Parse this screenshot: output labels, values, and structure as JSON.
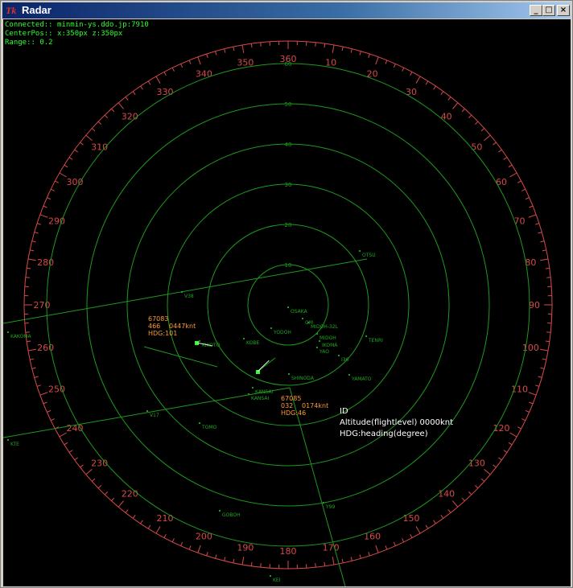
{
  "window": {
    "title": "Radar",
    "app_icon": "Tk",
    "controls": {
      "minimize": "_",
      "maximize": "□",
      "close": "×"
    }
  },
  "hud": {
    "connected": "Connected:: minmin-ys.ddo.jp:7910",
    "center_pos": "CenterPos:: x:350px z:350px",
    "range": "Range:: 0.2"
  },
  "colors": {
    "background": "#000000",
    "compass": "#d84a4a",
    "rings": "#1e9a1e",
    "aircraft_tag": "#ff9a30",
    "hud_text": "#2dff2d",
    "legend_text": "#ffffff"
  },
  "compass_labels": [
    "360",
    "10",
    "20",
    "30",
    "40",
    "50",
    "60",
    "70",
    "80",
    "90",
    "100",
    "110",
    "120",
    "130",
    "140",
    "150",
    "160",
    "170",
    "180",
    "190",
    "200",
    "210",
    "220",
    "230",
    "240",
    "250",
    "260",
    "270",
    "280",
    "290",
    "300",
    "310",
    "320",
    "330",
    "340",
    "350"
  ],
  "range_rings": [
    "10",
    "20",
    "30",
    "40",
    "50",
    "60"
  ],
  "fixes": [
    "OSAKA",
    "OM",
    "MIDOH-32L",
    "YODOH",
    "KOBE",
    "MIDOH",
    "TENRI",
    "IKOMA",
    "YAO",
    "I36",
    "YAMATO",
    "SHINODA",
    "KANSAI",
    "KANSAI",
    "TOMO",
    "GOBOH",
    "OTSU",
    "V38",
    "V17",
    "Y99",
    "KAKOMA",
    "KTE",
    "KEI",
    "KIKOTO"
  ],
  "aircraft": [
    {
      "id": "67083",
      "altitude": "466",
      "speed": "0447knt",
      "heading": "HDG:101"
    },
    {
      "id": "67085",
      "altitude": "032",
      "speed": "0174knt",
      "heading": "HDG:46"
    }
  ],
  "legend": {
    "line1": "ID",
    "line2": "Altitude(flightlevel)  0000knt",
    "line3": "HDG:heading(degree)"
  }
}
